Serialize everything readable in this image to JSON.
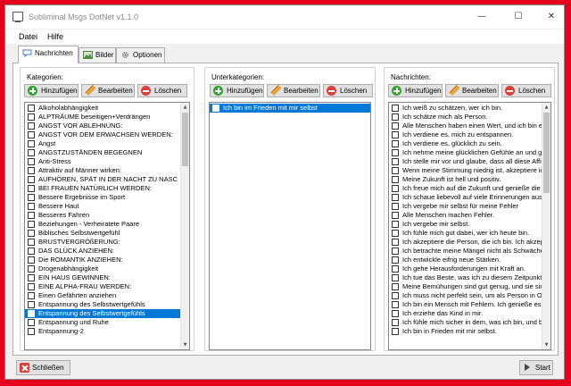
{
  "window": {
    "title": "Subliminal Msgs DotNet v1.1.0",
    "controls": {
      "minimize": "—",
      "maximize": "☐",
      "close": "✕"
    }
  },
  "menu": [
    "Datei",
    "Hilfe"
  ],
  "tabs": [
    {
      "label": "Nachrichten",
      "icon": "chat-icon",
      "active": true
    },
    {
      "label": "Bilder",
      "icon": "image-icon",
      "active": false
    },
    {
      "label": "Optionen",
      "icon": "gear-icon",
      "active": false
    }
  ],
  "buttons": {
    "add": "Hinzufügen",
    "edit": "Bearbeiten",
    "delete": "Löschen"
  },
  "categories": {
    "label": "Kategorien:",
    "selected_index": 23,
    "items": [
      "Alkoholabhängigkeit",
      "ALPTRÄUME beseitigen+Verdrängen",
      "ANGST VOR ABLEHNUNG:",
      "ANGST VOR DEM ERWACHSEN WERDEN:",
      "Angst",
      "ANGSTZUSTÄNDEN BEGEGNEN",
      "Anti-Stress",
      "Attraktiv auf Männer wirken:",
      "AUFHÖREN, SPÄT IN DER NACHT ZU NASC",
      "BEI FRAUEN NATÜRLICH WERDEN:",
      "Bessere Ergebnisse im Sport",
      "Bessere Haut",
      "Besseres Fahren",
      "Beziehungen - Verheiratete Paare",
      "Biblisches Selbstwertgefühl",
      "BRUSTVERGRÖßERUNG:",
      "DAS GLÜCK ANZIEHEN:",
      "Die ROMANTIK ANZIEHEN:",
      "Drogenabhängigkeit",
      "EIN HAUS GEWINNEN:",
      "EINE ALPHA-FRAU WERDEN:",
      "Einen Gefährten anziehen",
      "Entspannung des Selbstwertgefühls",
      "Entspannung des Selbstwertgefühls",
      "Entspannung und Ruhe",
      "Entspannung-2"
    ]
  },
  "subcategories": {
    "label": "Unterkategorien:",
    "selected_index": 0,
    "items": [
      "Ich bin im Frieden mit mir selbst"
    ]
  },
  "messages": {
    "label": "Nachrichten:",
    "items": [
      "Ich weiß zu schätzen, wer ich bin.",
      "Ich schätze mich als Person.",
      "Alle Menschen haben einen Wert, und ich bin e",
      "Ich verdiene es, mich zu entspannen.",
      "Ich verdiene es, glücklich zu sein.",
      "Ich nehme meine glücklichen Gefühle an und ge",
      "Ich stelle mir vor und glaube, dass all diese Affir",
      "Wenn meine Stimmung niedrig ist, akzeptiere ich",
      "Meine Zukunft ist hell und positiv.",
      "Ich freue mich auf die Zukunft und genieße die",
      "Ich schaue liebevoll auf viele Erinnerungen aus",
      "Ich vergebe mir selbst für meine Fehler",
      "Alle Menschen machen Fehler.",
      "Ich vergebe mir selbst.",
      "Ich fühle mich gut dabei, wer ich heute bin.",
      "Ich akzeptiere die Person, die ich bin. Ich akzep",
      "Ich betrachte meine Mängel nicht als Schwäche",
      "Ich entwickle eifrig neue Stärken.",
      "Ich gehe Herausforderungen mit Kraft an.",
      "Ich tue das Beste, was ich zu diesem Zeitpunkt",
      "Meine Bemühungen sind gut genug, und sie sin",
      "Ich muss nicht perfekt sein, um als Person in Or",
      "Ich bin ein Mensch mit Fehlern. Ich genieße es,",
      "Ich erziehe das Kind in mir.",
      "Ich fühle mich sicher in dem, was ich bin, und bi",
      "Ich bin in Frieden mit mir selbst."
    ]
  },
  "bottom": {
    "close": "Schließen",
    "start": "Start"
  }
}
